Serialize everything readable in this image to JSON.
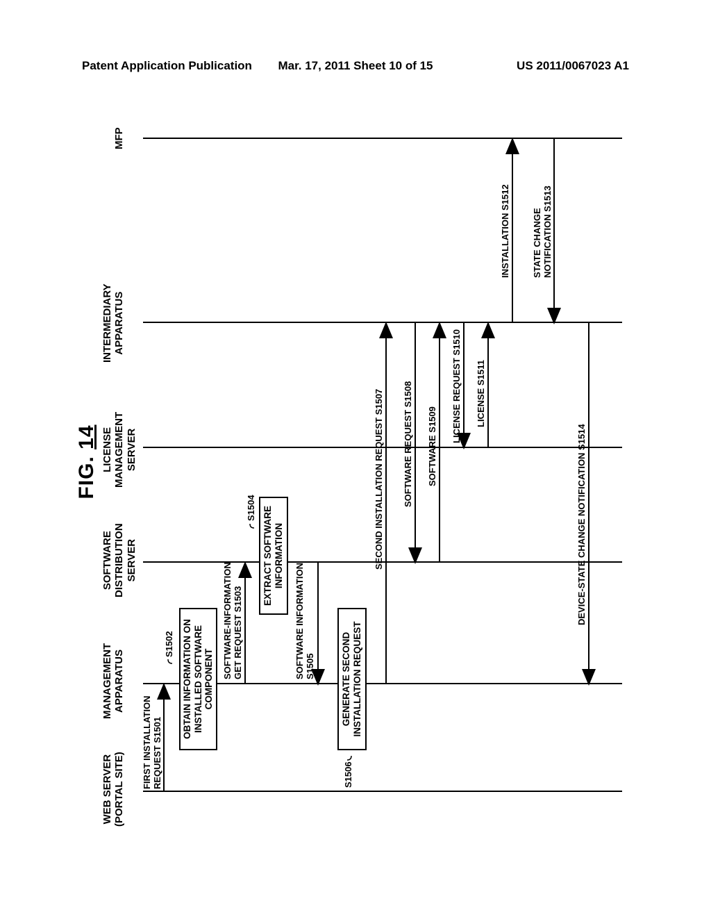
{
  "header": {
    "left": "Patent Application Publication",
    "center": "Mar. 17, 2011  Sheet 10 of 15",
    "right": "US 2011/0067023 A1"
  },
  "figure": {
    "title_prefix": "FIG.",
    "title_num": "14"
  },
  "actors": {
    "web": "WEB SERVER\n(PORTAL SITE)",
    "mgmt": "MANAGEMENT\nAPPARATUS",
    "dist": "SOFTWARE\nDISTRIBUTION\nSERVER",
    "lic": "LICENSE\nMANAGEMENT\nSERVER",
    "inter": "INTERMEDIARY\nAPPARATUS",
    "mfp": "MFP"
  },
  "boxes": {
    "b1502": "OBTAIN INFORMATION ON\nINSTALLED SOFTWARE\nCOMPONENT",
    "b1504": "EXTRACT SOFTWARE\nINFORMATION",
    "b1506": "GENERATE SECOND\nINSTALLATION REQUEST"
  },
  "labels": {
    "s1501": "FIRST INSTALLATION\nREQUEST S1501",
    "s1502": "S1502",
    "s1503": "SOFTWARE-INFORMATION\nGET REQUEST S1503",
    "s1504": "S1504",
    "s1505": "SOFTWARE INFORMATION\nS1505",
    "s1506": "S1506",
    "s1507": "SECOND INSTALLATION REQUEST S1507",
    "s1508": "SOFTWARE REQUEST S1508",
    "s1509": "SOFTWARE S1509",
    "s1510": "LICENSE REQUEST S1510",
    "s1511": "LICENSE S1511",
    "s1512": "INSTALLATION S1512",
    "s1513": "STATE CHANGE\nNOTIFICATION S1513",
    "s1514": "DEVICE-STATE CHANGE NOTIFICATION S1514"
  }
}
